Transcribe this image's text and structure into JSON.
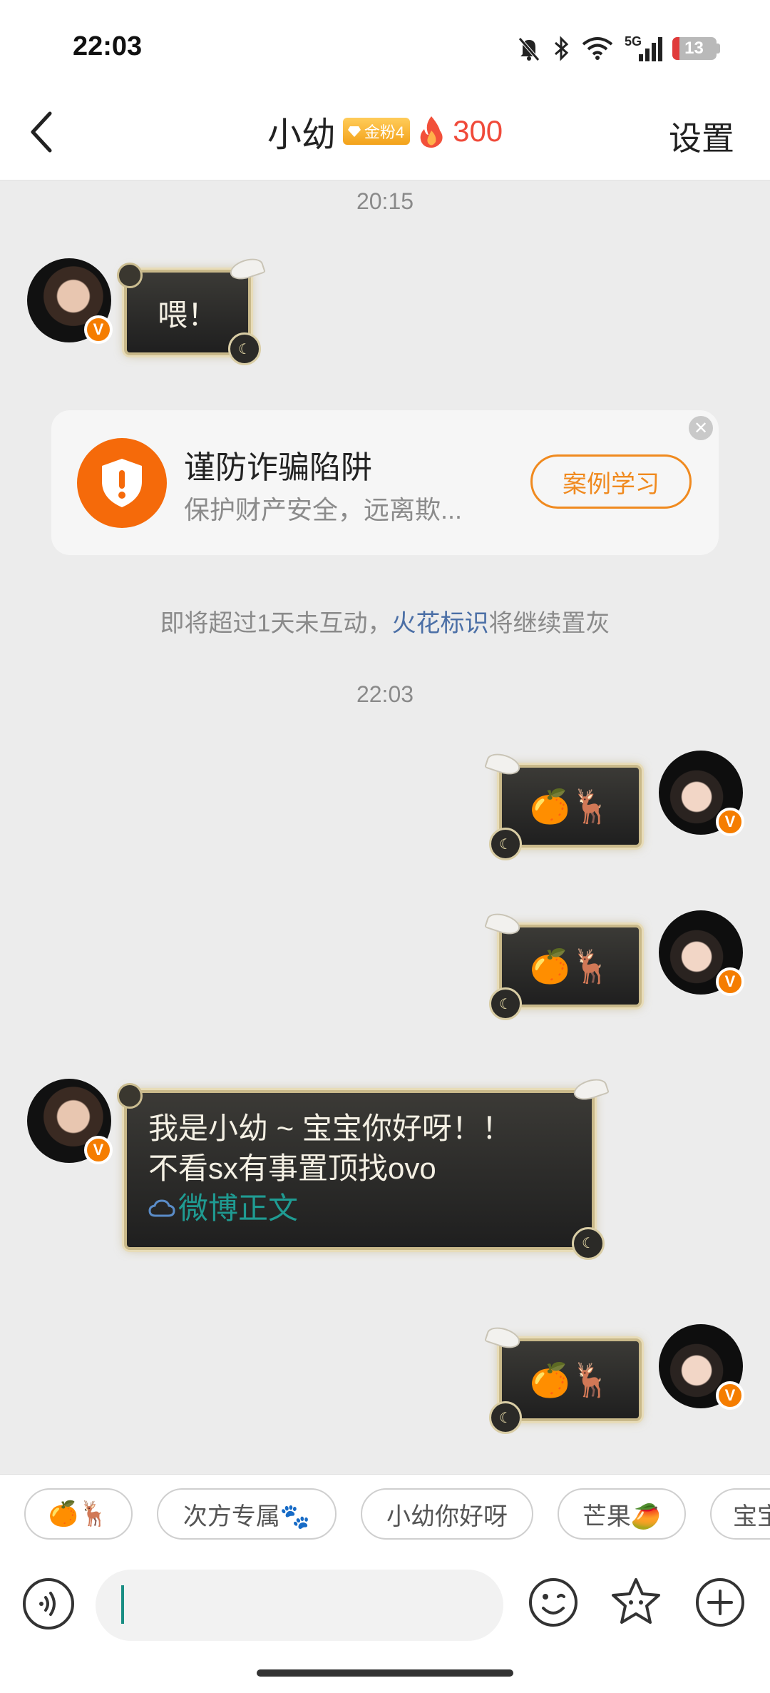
{
  "status_bar": {
    "time": "22:03",
    "network": "5G",
    "battery": "13"
  },
  "header": {
    "back_icon": "chevron-left-icon",
    "title": "小幼",
    "badge": "金粉4",
    "spark_count": "300",
    "settings_label": "设置"
  },
  "chat": {
    "timestamp_1": "20:15",
    "msg_1": {
      "sender": "other",
      "text": "喂！"
    },
    "fraud_card": {
      "title": "谨防诈骗陷阱",
      "desc": "保护财产安全，远离欺...",
      "button": "案例学习"
    },
    "spark_notice": {
      "before": "即将超过1天未互动，",
      "link": "火花标识",
      "after": "将继续置灰"
    },
    "timestamp_2": "22:03",
    "msg_2": {
      "sender": "me",
      "text": "🍊🦌"
    },
    "msg_3": {
      "sender": "me",
      "text": "🍊🦌"
    },
    "msg_4": {
      "sender": "other",
      "line1": "我是小幼 ~ 宝宝你好呀！！",
      "line2": "不看sx有事置顶找ovo",
      "link": "微博正文"
    },
    "msg_5": {
      "sender": "me",
      "text": "🍊🦌"
    }
  },
  "quick_replies": [
    "🍊🦌",
    "次方专属🐾",
    "小幼你好呀",
    "芒果🥭",
    "宝宝"
  ],
  "input": {
    "placeholder": "",
    "voice_icon": "voice-icon",
    "emoji_icon": "emoji-icon",
    "sticker_icon": "sticker-icon",
    "plus_icon": "plus-icon"
  },
  "colors": {
    "accent_orange": "#f56a0a",
    "spark_red": "#f04a3a",
    "link_blue": "#4b6fa6"
  }
}
